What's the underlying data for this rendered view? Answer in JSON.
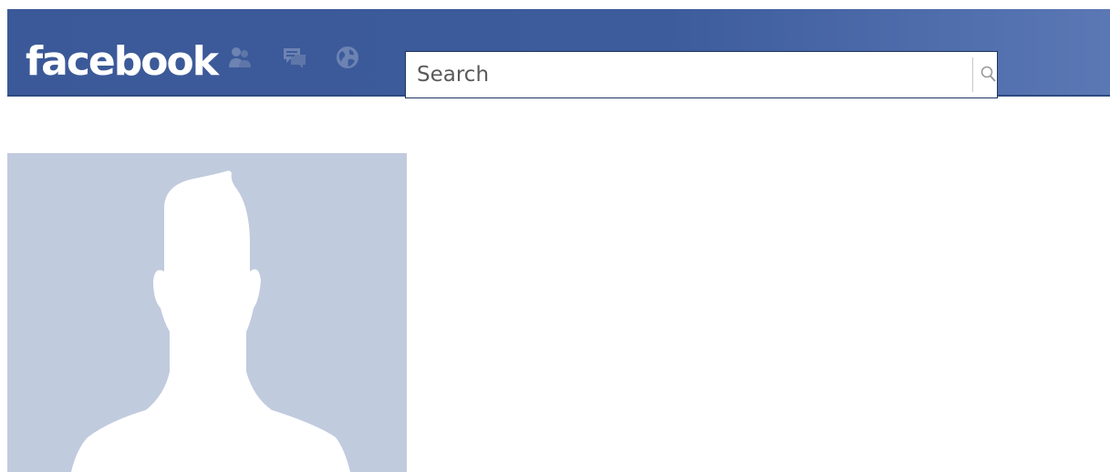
{
  "header": {
    "logo_text": "facebook",
    "jewels": [
      {
        "name": "friend-requests-icon"
      },
      {
        "name": "messages-icon"
      },
      {
        "name": "notifications-globe-icon"
      }
    ],
    "search": {
      "placeholder": "Search",
      "icon": "magnifier-icon"
    }
  },
  "profile": {
    "avatar": "default-silhouette"
  },
  "colors": {
    "brand": "#3b5998",
    "avatar_bg": "#c1cbde",
    "silhouette": "#ffffff",
    "jewel": "#7186b3"
  }
}
